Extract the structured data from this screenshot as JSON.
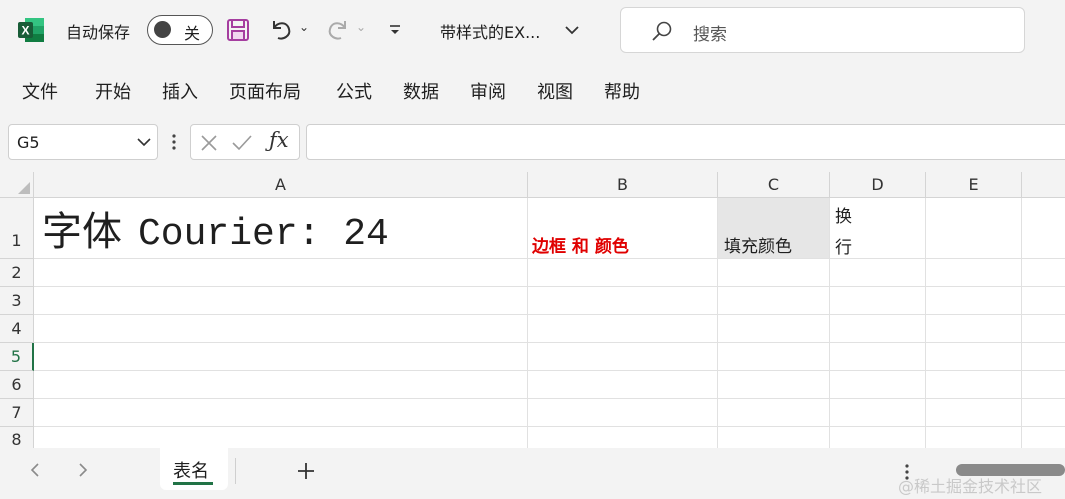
{
  "titlebar": {
    "autosave_label": "自动保存",
    "autosave_state": "关",
    "doc_title": "带样式的EX...",
    "search_placeholder": "搜索"
  },
  "ribbon": {
    "tabs": [
      "文件",
      "开始",
      "插入",
      "页面布局",
      "公式",
      "数据",
      "审阅",
      "视图",
      "帮助"
    ]
  },
  "formula_bar": {
    "name_box": "G5",
    "formula_value": ""
  },
  "grid": {
    "columns": [
      "A",
      "B",
      "C",
      "D",
      "E"
    ],
    "rows": [
      "1",
      "2",
      "3",
      "4",
      "5",
      "6",
      "7",
      "8"
    ],
    "active_row": "5",
    "cells": {
      "A1_cjk": "字体",
      "A1_latin": "Courier: 24",
      "B1": "边框 和 颜色",
      "C1": "填充颜色",
      "D1_line1": "换",
      "D1_line2": "行"
    },
    "colors": {
      "B1_text": "#e00000",
      "C1_fill": "#e6e6e6",
      "active_row_marker": "#217346"
    }
  },
  "sheets": {
    "tabs": [
      "表名"
    ],
    "active": "表名"
  },
  "watermark": "@稀土掘金技术社区"
}
